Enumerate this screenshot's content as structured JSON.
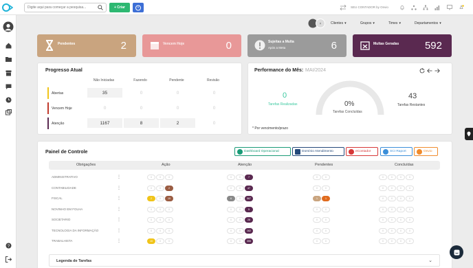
{
  "topbar": {
    "search_placeholder": "Digite aqui para começar a pesquisa...",
    "create_label": "+ Criar",
    "accountant_label": "SEU CONTADOR by Onvio"
  },
  "filters": [
    {
      "label": "Clientes"
    },
    {
      "label": "Grupos"
    },
    {
      "label": "Times"
    },
    {
      "label": "Departamentos"
    }
  ],
  "cards": [
    {
      "label": "Pendentes",
      "sub": "",
      "value": "2",
      "color": "#c9a47f"
    },
    {
      "label": "Vencem Hoje",
      "sub": "",
      "value": "0",
      "color": "#e89898"
    },
    {
      "label": "Sujeitas a Multa",
      "sub": "Após a Meta",
      "value": "6",
      "color": "#9b9b9b"
    },
    {
      "label": "Multas Geradas",
      "sub": "",
      "value": "592",
      "color": "#5a2950"
    }
  ],
  "progress": {
    "title": "Progresso Atual",
    "headers": [
      "Não Iniciadas",
      "Fazendo",
      "Pendente",
      "Revisão"
    ],
    "rows": [
      {
        "label": "Abertas",
        "values": [
          "35",
          "0",
          "0",
          "0"
        ],
        "color": "#f0c419"
      },
      {
        "label": "Vencem Hoje",
        "values": [
          "0",
          "0",
          "0",
          "0"
        ],
        "color": "#c0392b"
      },
      {
        "label": "Atenção",
        "values": [
          "1167",
          "8",
          "2",
          "0"
        ],
        "color": "#5a2950"
      }
    ]
  },
  "performance": {
    "title": "Performance do Mês:",
    "period": "MAI/2024",
    "done_value": "0",
    "done_label": "Tarefas Realizadas",
    "pct": "0%",
    "pct_label": "Tarefas Concluídas",
    "remaining_value": "43",
    "remaining_label": "Tarefas Restantes",
    "footnote": "* Por vencimento/prazo"
  },
  "panel": {
    "title": "Painel de Controle",
    "systems": [
      {
        "label": "Dashboard Operacional",
        "color": "#1a9b77"
      },
      {
        "label": "Domínio Atendimento",
        "color": "#24497a"
      },
      {
        "label": "eContador",
        "color": "#d63737"
      },
      {
        "label": "SCI Raport",
        "color": "#3c8fd9"
      },
      {
        "label": "Onvio",
        "color": "#f08b2d"
      }
    ],
    "columns": [
      "Obrigações",
      "Ação",
      "Atenção",
      "Pendentes",
      "Concluídas"
    ],
    "categories": [
      {
        "name": "ADMINISTRATIVO",
        "acao": [
          "0",
          "0",
          "0"
        ],
        "atencao": [
          "0",
          "0",
          "7"
        ],
        "pend": [
          "0",
          "0"
        ],
        "conc": [
          "0",
          "0",
          "0",
          "0"
        ]
      },
      {
        "name": "CONTABILIDADE",
        "acao": [
          "0",
          "0",
          "2"
        ],
        "atencao": [
          "0",
          "0",
          "47"
        ],
        "pend": [
          "0",
          "0"
        ],
        "conc": [
          "0",
          "0",
          "0",
          "0"
        ]
      },
      {
        "name": "FISCAL",
        "acao": [
          "2",
          "0",
          "19"
        ],
        "atencao": [
          "6",
          "0",
          "567"
        ],
        "pend": [
          "1",
          "1"
        ],
        "conc": [
          "0",
          "0",
          "0",
          "0"
        ]
      },
      {
        "name": "NOVINHO EM FOLHA",
        "acao": [
          "0",
          "0",
          "0"
        ],
        "atencao": [
          "0",
          "0",
          "5"
        ],
        "pend": [
          "0",
          "0"
        ],
        "conc": [
          "0",
          "0",
          "0",
          "0"
        ]
      },
      {
        "name": "SOCIETARIO",
        "acao": [
          "0",
          "0",
          "0"
        ],
        "atencao": [
          "0",
          "0",
          "28"
        ],
        "pend": [
          "0",
          "0"
        ],
        "conc": [
          "0",
          "0",
          "0",
          "0"
        ]
      },
      {
        "name": "TECNOLOGIA DA INFORMAÇÃO",
        "acao": [
          "0",
          "0",
          "0"
        ],
        "atencao": [
          "0",
          "0",
          "162"
        ],
        "pend": [
          "0",
          "0"
        ],
        "conc": [
          "0",
          "0",
          "0",
          "0"
        ]
      },
      {
        "name": "TRABALHISTA",
        "acao": [
          "15",
          "0",
          "0"
        ],
        "atencao": [
          "0",
          "0",
          "355"
        ],
        "pend": [
          "0",
          "0"
        ],
        "conc": [
          "0",
          "0",
          "0",
          "0"
        ]
      }
    ],
    "legend_label": "Legenda de Tarefas"
  }
}
